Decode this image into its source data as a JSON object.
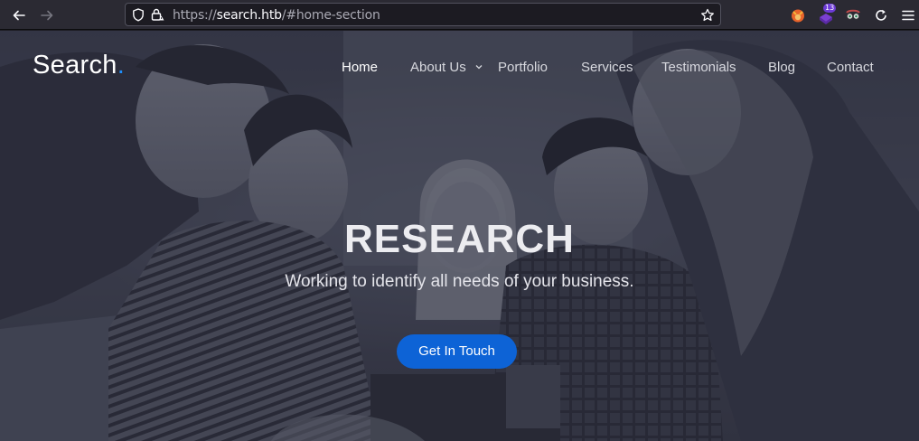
{
  "browser": {
    "url_scheme": "https://",
    "url_host": "search.htb",
    "url_path": "/#home-section",
    "extension_badge": "13"
  },
  "site": {
    "brand": "Search",
    "brand_dot": ".",
    "nav": [
      {
        "label": "Home"
      },
      {
        "label": "About Us"
      },
      {
        "label": "Portfolio"
      },
      {
        "label": "Services"
      },
      {
        "label": "Testimonials"
      },
      {
        "label": "Blog"
      },
      {
        "label": "Contact"
      }
    ],
    "hero": {
      "title": "RESEARCH",
      "subtitle": "Working to identify all needs of your business.",
      "cta": "Get In Touch"
    }
  },
  "colors": {
    "accent": "#0d63d6",
    "brand_dot": "#1e90ff"
  },
  "icons": {
    "back": "arrow-left-icon",
    "forward": "arrow-right-icon",
    "tracking": "shield-icon",
    "lock": "lock-warning-icon",
    "bookmark": "star-icon",
    "reload": "reload-icon",
    "menu": "hamburger-menu-icon"
  }
}
